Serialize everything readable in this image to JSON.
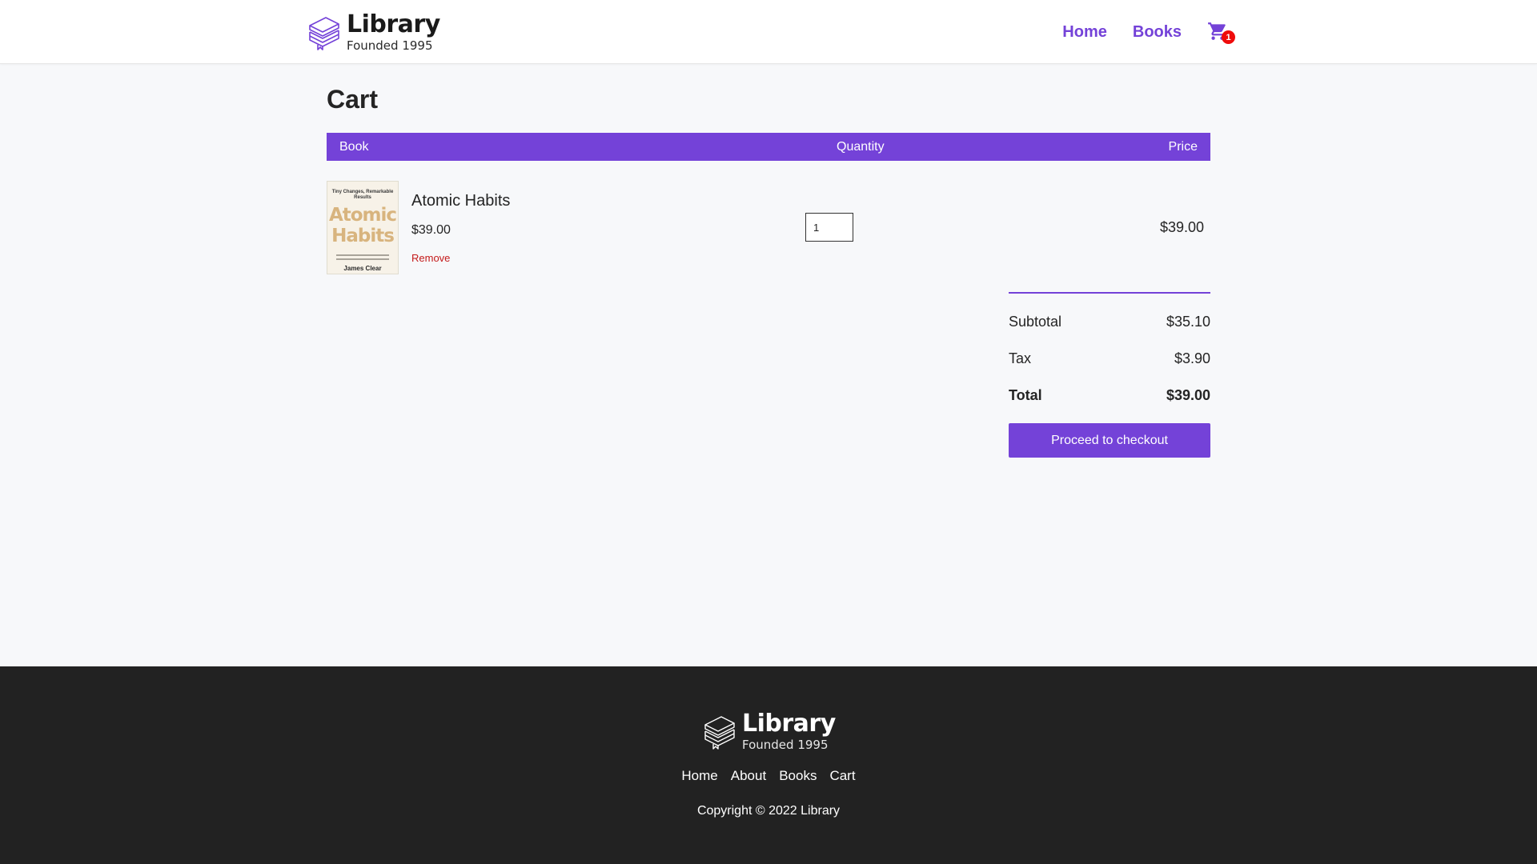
{
  "brand": {
    "name": "Library",
    "tagline": "Founded 1995",
    "accent_color": "#7442d8",
    "icon": "stacked-books-logo"
  },
  "header": {
    "nav": [
      "Home",
      "Books"
    ],
    "cart_icon": "shopping-cart-icon",
    "cart_count": "1"
  },
  "page": {
    "title": "Cart"
  },
  "cart_table": {
    "columns": [
      "Book",
      "Quantity",
      "Price"
    ],
    "items": [
      {
        "title": "Atomic Habits",
        "unit_price": "$39.00",
        "remove_label": "Remove",
        "quantity": "1",
        "line_price": "$39.00",
        "cover": {
          "tagline": "Tiny Changes, Remarkable Results",
          "title_line1": "Atomic",
          "title_line2": "Habits",
          "author": "James Clear"
        }
      }
    ]
  },
  "summary": {
    "subtotal_label": "Subtotal",
    "subtotal_value": "$35.10",
    "tax_label": "Tax",
    "tax_value": "$3.90",
    "total_label": "Total",
    "total_value": "$39.00",
    "checkout_label": "Proceed to checkout"
  },
  "footer": {
    "links": [
      "Home",
      "About",
      "Books",
      "Cart"
    ],
    "copyright": "Copyright © 2022 Library",
    "background_color": "#222222"
  }
}
